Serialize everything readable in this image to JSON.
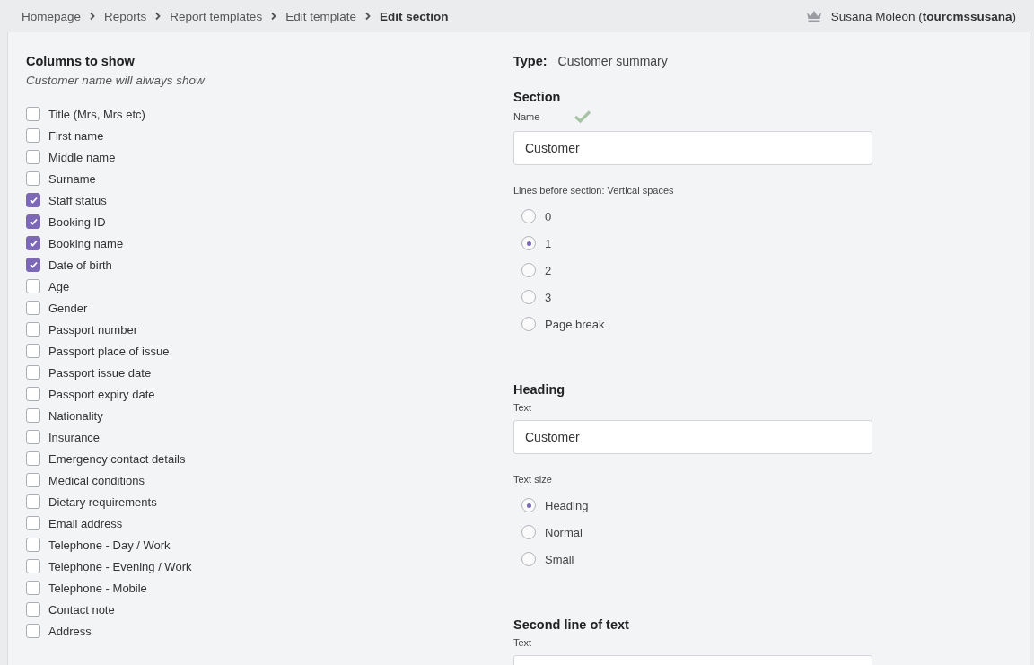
{
  "breadcrumbs": [
    {
      "label": "Homepage",
      "current": false
    },
    {
      "label": "Reports",
      "current": false
    },
    {
      "label": "Report templates",
      "current": false
    },
    {
      "label": "Edit template",
      "current": false
    },
    {
      "label": "Edit section",
      "current": true
    }
  ],
  "user": {
    "name": "Susana Moleón",
    "username": "(**tourcmssusana**)"
  },
  "columns_panel": {
    "title": "Columns to show",
    "note": "Customer name will always show",
    "options": [
      {
        "label": "Title (Mrs, Mrs etc)",
        "checked": false
      },
      {
        "label": "First name",
        "checked": false
      },
      {
        "label": "Middle name",
        "checked": false
      },
      {
        "label": "Surname",
        "checked": false
      },
      {
        "label": "Staff status",
        "checked": true
      },
      {
        "label": "Booking ID",
        "checked": true
      },
      {
        "label": "Booking name",
        "checked": true
      },
      {
        "label": "Date of birth",
        "checked": true
      },
      {
        "label": "Age",
        "checked": false
      },
      {
        "label": "Gender",
        "checked": false
      },
      {
        "label": "Passport number",
        "checked": false
      },
      {
        "label": "Passport place of issue",
        "checked": false
      },
      {
        "label": "Passport issue date",
        "checked": false
      },
      {
        "label": "Passport expiry date",
        "checked": false
      },
      {
        "label": "Nationality",
        "checked": false
      },
      {
        "label": "Insurance",
        "checked": false
      },
      {
        "label": "Emergency contact details",
        "checked": false
      },
      {
        "label": "Medical conditions",
        "checked": false
      },
      {
        "label": "Dietary requirements",
        "checked": false
      },
      {
        "label": "Email address",
        "checked": false
      },
      {
        "label": "Telephone - Day / Work",
        "checked": false
      },
      {
        "label": "Telephone - Evening / Work",
        "checked": false
      },
      {
        "label": "Telephone - Mobile",
        "checked": false
      },
      {
        "label": "Contact note",
        "checked": false
      },
      {
        "label": "Address",
        "checked": false
      }
    ]
  },
  "type": {
    "label": "Type:",
    "value": "Customer summary"
  },
  "section": {
    "title": "Section",
    "name_label": "Name",
    "name_valid": true,
    "name_value": "Customer",
    "lines_label": "Lines before section: Vertical spaces",
    "lines_options": [
      {
        "label": "0",
        "selected": false
      },
      {
        "label": "1",
        "selected": true
      },
      {
        "label": "2",
        "selected": false
      },
      {
        "label": "3",
        "selected": false
      },
      {
        "label": "Page break",
        "selected": false
      }
    ]
  },
  "heading": {
    "title": "Heading",
    "text_label": "Text",
    "text_value": "Customer",
    "size_label": "Text size",
    "size_options": [
      {
        "label": "Heading",
        "selected": true
      },
      {
        "label": "Normal",
        "selected": false
      },
      {
        "label": "Small",
        "selected": false
      }
    ]
  },
  "second_line": {
    "title": "Second line of text",
    "text_label": "Text"
  }
}
